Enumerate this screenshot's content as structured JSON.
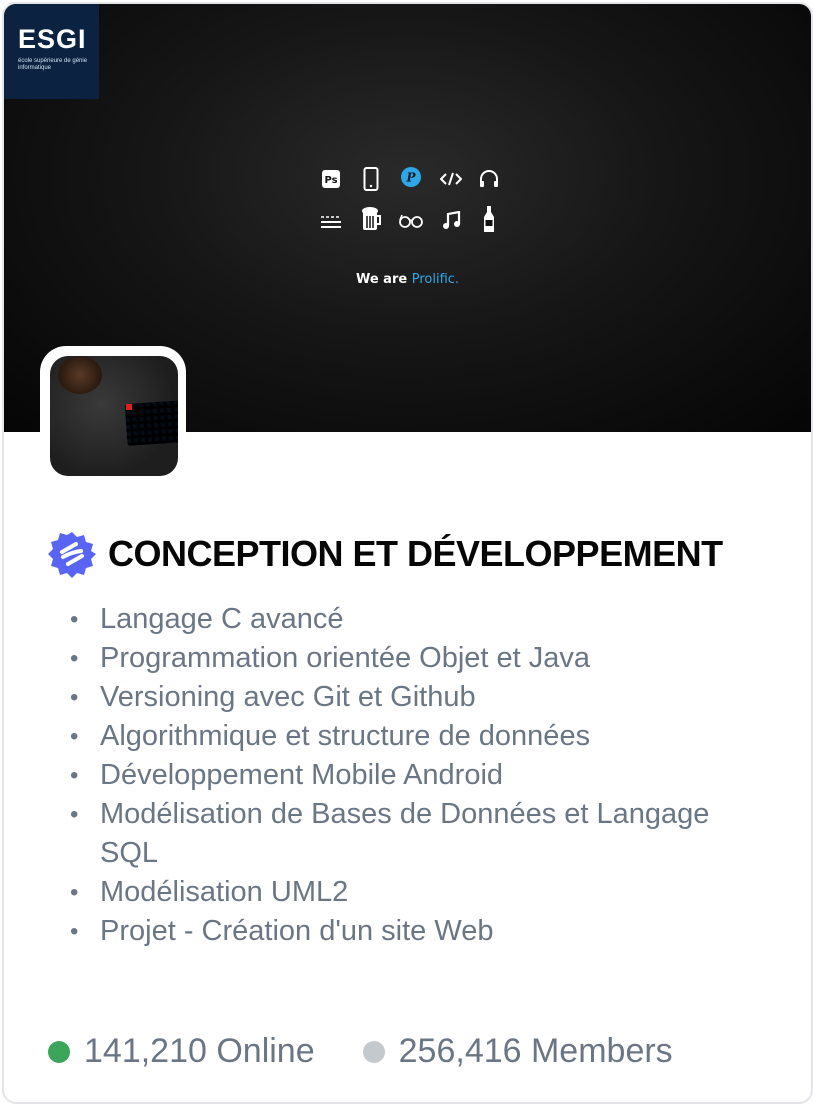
{
  "banner": {
    "logo": {
      "word": "ESGI",
      "subtitle": "école supérieure de génie informatique"
    },
    "icons": [
      "photoshop-icon",
      "smartphone-icon",
      "prolific-icon",
      "code-icon",
      "headphones-icon",
      "lines-icon",
      "beer-icon",
      "glasses-icon",
      "music-note-icon",
      "bottle-icon"
    ],
    "tagline_prefix": "We are",
    "tagline_accent": "Prolific.",
    "accent_color": "#2fa6e6"
  },
  "server": {
    "title": "CONCEPTION ET DÉVELOPPEMENT",
    "badge_color": "#5865f2",
    "courses": [
      "Langage C avancé",
      "Programmation orientée Objet et Java",
      "Versioning avec Git et Github",
      "Algorithmique et structure de données",
      "Développement Mobile Android",
      "Modélisation de Bases de Données et Langage SQL",
      "Modélisation UML2",
      "Projet - Création d'un site Web"
    ]
  },
  "stats": {
    "online": "141,210 Online",
    "members": "256,416 Members",
    "online_color": "#3ba55c",
    "members_color": "#c4c9ce"
  }
}
